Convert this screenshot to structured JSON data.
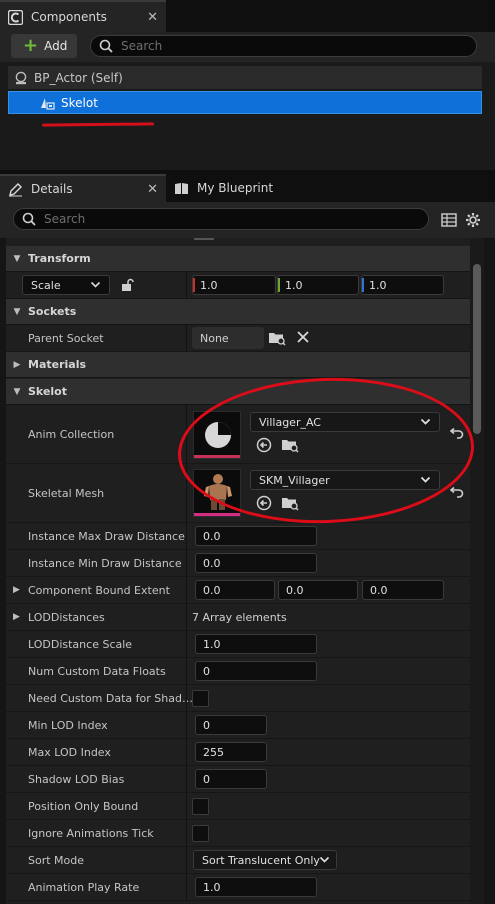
{
  "components_panel": {
    "tab_label": "Components",
    "add_label": "Add",
    "search_placeholder": "Search",
    "tree": {
      "root_label": "BP_Actor (Self)",
      "selected_label": "Skelot"
    }
  },
  "details_panel": {
    "tabs": [
      "Details",
      "My Blueprint"
    ],
    "search_placeholder": "Search",
    "sections": {
      "transform": "Transform",
      "sockets": "Sockets",
      "materials": "Materials",
      "skelot": "Skelot"
    },
    "transform": {
      "mode": "Scale",
      "x": "1.0",
      "y": "1.0",
      "z": "1.0"
    },
    "sockets": {
      "parent_socket_label": "Parent Socket",
      "parent_socket_value": "None"
    },
    "skelot": {
      "anim_collection_label": "Anim Collection",
      "anim_collection_value": "Villager_AC",
      "skeletal_mesh_label": "Skeletal Mesh",
      "skeletal_mesh_value": "SKM_Villager"
    },
    "properties": [
      {
        "label": "Instance Max Draw Distance",
        "value": "0.0"
      },
      {
        "label": "Instance Min Draw Distance",
        "value": "0.0"
      },
      {
        "label": "Component Bound Extent",
        "x": "0.0",
        "y": "0.0",
        "z": "0.0"
      },
      {
        "label": "LODDistances",
        "value": "7 Array elements"
      },
      {
        "label": "LODDistance Scale",
        "value": "1.0"
      },
      {
        "label": "Num Custom Data Floats",
        "value": "0"
      },
      {
        "label": "Need Custom Data for Shad…"
      },
      {
        "label": "Min LOD Index",
        "value": "0"
      },
      {
        "label": "Max LOD Index",
        "value": "255"
      },
      {
        "label": "Shadow LOD Bias",
        "value": "0"
      },
      {
        "label": "Position Only Bound"
      },
      {
        "label": "Ignore Animations Tick"
      },
      {
        "label": "Sort Mode",
        "value": "Sort Translucent Only"
      },
      {
        "label": "Animation Play Rate",
        "value": "1.0"
      }
    ]
  },
  "colors": {
    "selection": "#0e70d8",
    "annotation_red": "#dc0c18",
    "add_plus": "#6fbd3b",
    "x_axis": "#c8302c",
    "y_axis": "#6fa82c",
    "z_axis": "#2d74d8",
    "anim_thumb_bar": "#c8325a",
    "mesh_thumb_bar": "#d62c83"
  }
}
